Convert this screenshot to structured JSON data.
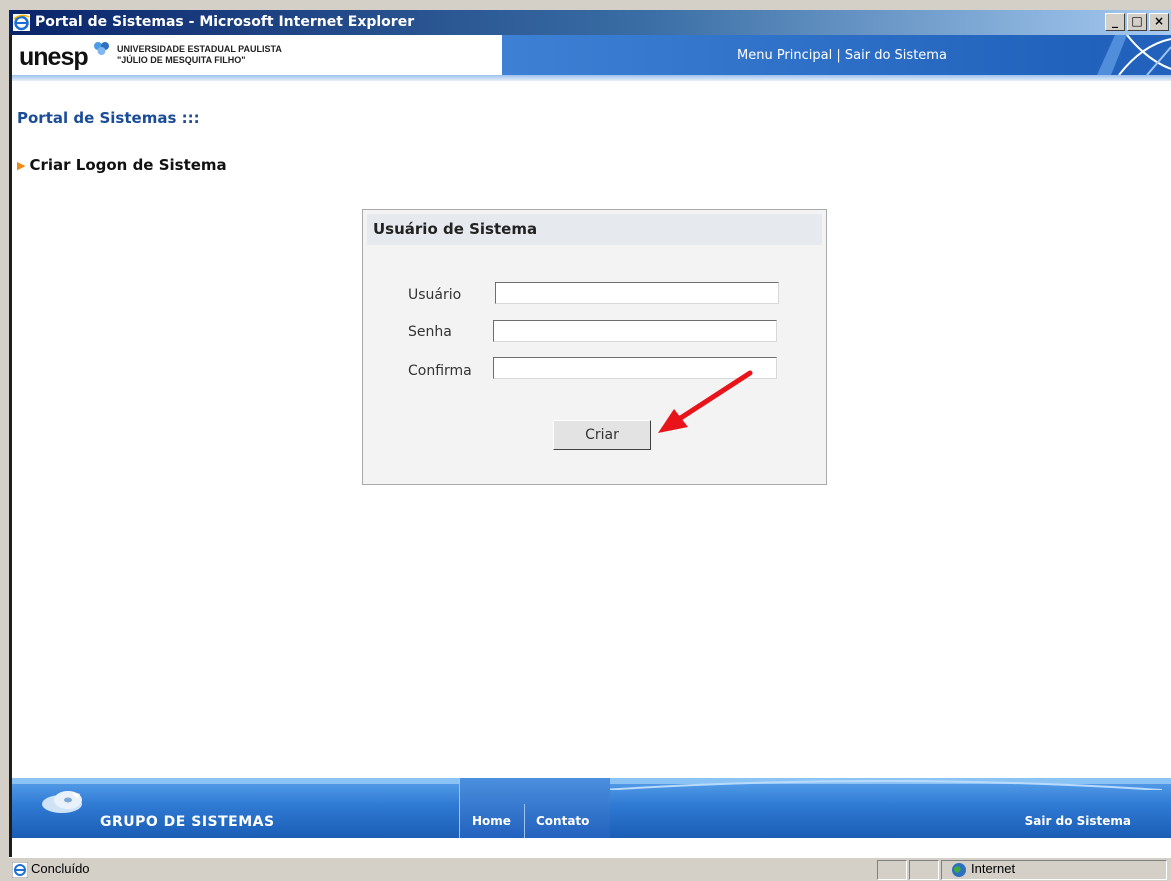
{
  "window": {
    "title": "Portal de Sistemas - Microsoft Internet Explorer"
  },
  "header": {
    "logo_text": "unesp",
    "university_line1": "UNIVERSIDADE ESTADUAL PAULISTA",
    "university_line2": "\"JÚLIO DE MESQUITA FILHO\"",
    "nav_menu": "Menu Principal",
    "nav_separator": "|",
    "nav_logout": "Sair do Sistema"
  },
  "page": {
    "title": "Portal de Sistemas :::",
    "section": "Criar Logon de Sistema"
  },
  "form": {
    "heading": "Usuário de Sistema",
    "user_label": "Usuário",
    "user_value": "",
    "password_label": "Senha",
    "password_value": "",
    "confirm_label": "Confirma",
    "confirm_value": "",
    "submit_label": "Criar"
  },
  "footer": {
    "brand": "GRUPO DE SISTEMAS",
    "home": "Home",
    "contact": "Contato",
    "logout": "Sair do Sistema"
  },
  "statusbar": {
    "status": "Concluído",
    "zone": "Internet"
  }
}
